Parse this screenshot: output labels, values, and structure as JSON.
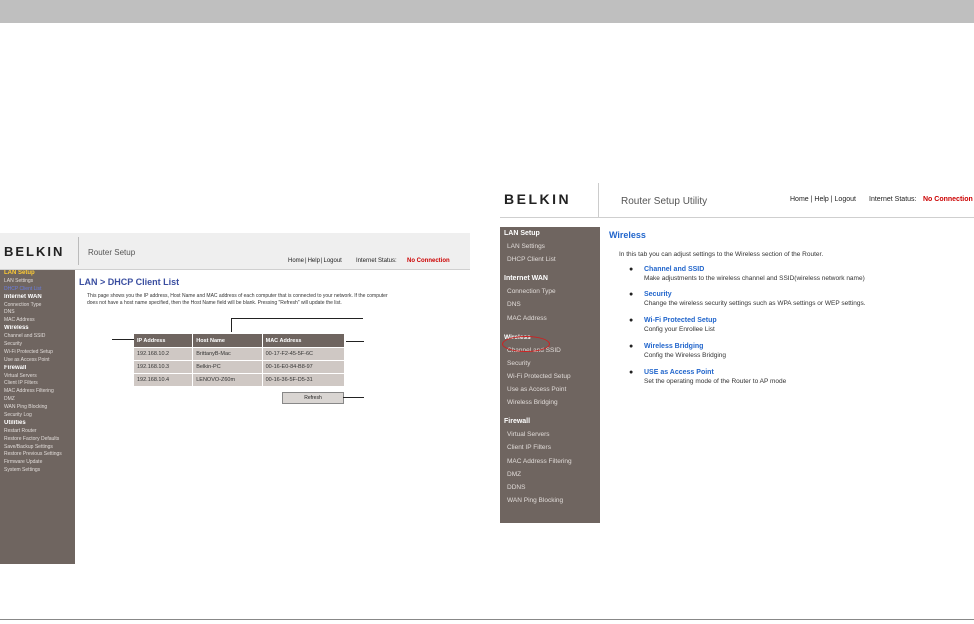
{
  "dhcp_screen": {
    "logo": "BELKIN",
    "title": "Router Setup",
    "header_links": [
      "Home",
      "Help",
      "Logout"
    ],
    "status_label": "Internet Status:",
    "status_value": "No Connection",
    "sidebar": [
      {
        "label": "LAN Setup",
        "kind": "head-active"
      },
      {
        "label": "LAN Settings",
        "kind": "item"
      },
      {
        "label": "DHCP Client List",
        "kind": "current"
      },
      {
        "label": "Internet WAN",
        "kind": "head"
      },
      {
        "label": "Connection Type",
        "kind": "item"
      },
      {
        "label": "DNS",
        "kind": "item"
      },
      {
        "label": "MAC Address",
        "kind": "item"
      },
      {
        "label": "Wireless",
        "kind": "head"
      },
      {
        "label": "Channel and SSID",
        "kind": "item"
      },
      {
        "label": "Security",
        "kind": "item"
      },
      {
        "label": "Wi-Fi Protected Setup",
        "kind": "item"
      },
      {
        "label": "Use as Access Point",
        "kind": "item"
      },
      {
        "label": "Firewall",
        "kind": "head"
      },
      {
        "label": "Virtual Servers",
        "kind": "item"
      },
      {
        "label": "Client IP Filters",
        "kind": "item"
      },
      {
        "label": "MAC Address Filtering",
        "kind": "item"
      },
      {
        "label": "DMZ",
        "kind": "item"
      },
      {
        "label": "WAN Ping Blocking",
        "kind": "item"
      },
      {
        "label": "Security Log",
        "kind": "item"
      },
      {
        "label": "Utilities",
        "kind": "head"
      },
      {
        "label": "Restart Router",
        "kind": "item"
      },
      {
        "label": "Restore Factory Defaults",
        "kind": "item"
      },
      {
        "label": "Save/Backup Settings",
        "kind": "item"
      },
      {
        "label": "Restore Previous Settings",
        "kind": "item"
      },
      {
        "label": "Firmware Update",
        "kind": "item"
      },
      {
        "label": "System Settings",
        "kind": "item"
      }
    ],
    "page_title": "LAN > DHCP Client List",
    "description": "This page shows you the IP address, Host Name and MAC address of each computer that is connected to your network. If the computer does not have a host name specified, then the Host Name field will be blank. Pressing \"Refresh\" will update the list.",
    "table_headers": [
      "IP Address",
      "Host Name",
      "MAC Address"
    ],
    "table_rows": [
      [
        "192.168.10.2",
        "BrittanyB-Mac",
        "00-17-F2-45-5F-6C"
      ],
      [
        "192.168.10.3",
        "Belkin-PC",
        "00-16-E0-84-B8-97"
      ],
      [
        "192.168.10.4",
        "LENOVO-Z60m",
        "00-16-36-5F-D5-31"
      ]
    ],
    "refresh_label": "Refresh"
  },
  "wireless_screen": {
    "logo": "BELKIN",
    "title": "Router Setup Utility",
    "header_links": [
      "Home",
      "Help",
      "Logout"
    ],
    "status_label": "Internet Status:",
    "status_value": "No Connection",
    "sidebar": [
      {
        "label": "LAN Setup",
        "kind": "head"
      },
      {
        "label": "LAN Settings",
        "kind": "item"
      },
      {
        "label": "DHCP Client List",
        "kind": "item"
      },
      {
        "label": "",
        "kind": "spacer"
      },
      {
        "label": "Internet WAN",
        "kind": "head"
      },
      {
        "label": "Connection Type",
        "kind": "item"
      },
      {
        "label": "DNS",
        "kind": "item"
      },
      {
        "label": "MAC Address",
        "kind": "item"
      },
      {
        "label": "",
        "kind": "spacer"
      },
      {
        "label": "Wireless",
        "kind": "current"
      },
      {
        "label": "Channel and SSID",
        "kind": "item"
      },
      {
        "label": "Security",
        "kind": "item"
      },
      {
        "label": "Wi-Fi Protected Setup",
        "kind": "item"
      },
      {
        "label": "Use as Access Point",
        "kind": "item"
      },
      {
        "label": "Wireless Bridging",
        "kind": "item"
      },
      {
        "label": "",
        "kind": "spacer"
      },
      {
        "label": "Firewall",
        "kind": "head"
      },
      {
        "label": "Virtual Servers",
        "kind": "item"
      },
      {
        "label": "Client IP Filters",
        "kind": "item"
      },
      {
        "label": "MAC Address Filtering",
        "kind": "item"
      },
      {
        "label": "DMZ",
        "kind": "item"
      },
      {
        "label": "DDNS",
        "kind": "item"
      },
      {
        "label": "WAN Ping Blocking",
        "kind": "item"
      }
    ],
    "page_title": "Wireless",
    "intro": "In this tab you can adjust settings to the Wireless section of the Router.",
    "items": [
      {
        "title": "Channel and SSID",
        "desc": "Make adjustments to the wireless channel and SSID(wireless network name)"
      },
      {
        "title": "Security",
        "desc": "Change the wireless security settings such as WPA settings or WEP settings."
      },
      {
        "title": "Wi-Fi Protected Setup",
        "desc": "Config your Enrollee List"
      },
      {
        "title": "Wireless Bridging",
        "desc": "Config the Wireless Bridging"
      },
      {
        "title": "USE as Access Point",
        "desc": "Set the operating mode of the Router to AP mode"
      }
    ]
  },
  "colors": {
    "sidebar_bg": "#6f6560",
    "link_blue": "#2266cc",
    "status_red": "#cc0000",
    "title_blue": "#3a4ea0",
    "highlight_circle": "#cc2222"
  }
}
